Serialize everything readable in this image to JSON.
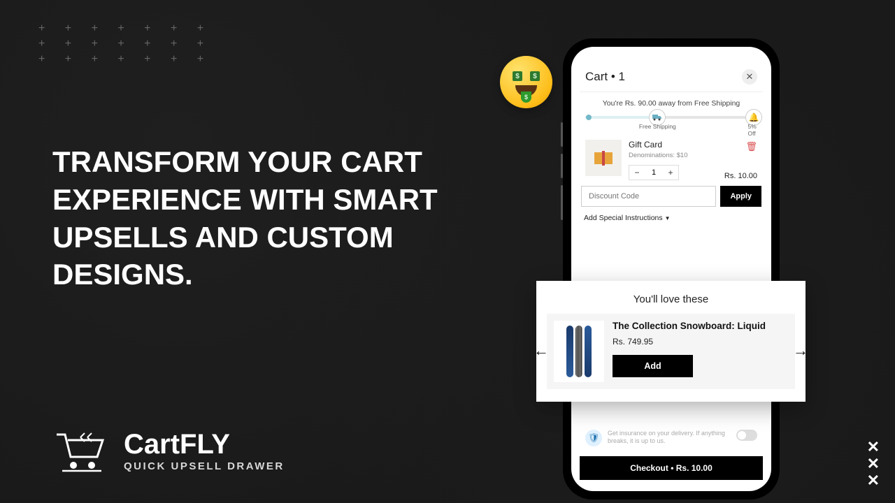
{
  "headline": "TRANSFORM YOUR CART EXPERIENCE WITH SMART UPSELLS AND CUSTOM DESIGNS.",
  "brand": {
    "name": "CartFLY",
    "tagline": "QUICK UPSELL DRAWER"
  },
  "cart": {
    "title": "Cart • 1",
    "shipping_message": "You're Rs. 90.00 away from Free Shipping",
    "milestones": {
      "free_shipping": "Free Shipping",
      "off": "5% Off"
    },
    "item": {
      "title": "Gift Card",
      "subtitle": "Denominations: $10",
      "qty": "1",
      "price": "Rs. 10.00"
    },
    "discount_placeholder": "Discount Code",
    "apply": "Apply",
    "special": "Add Special Instructions",
    "insurance": "Get insurance on your delivery. If anything breaks, it is up to us.",
    "checkout": "Checkout • Rs. 10.00"
  },
  "upsell": {
    "heading": "You'll love these",
    "item": {
      "title": "The Collection Snowboard: Liquid",
      "price": "Rs. 749.95",
      "add": "Add"
    }
  }
}
